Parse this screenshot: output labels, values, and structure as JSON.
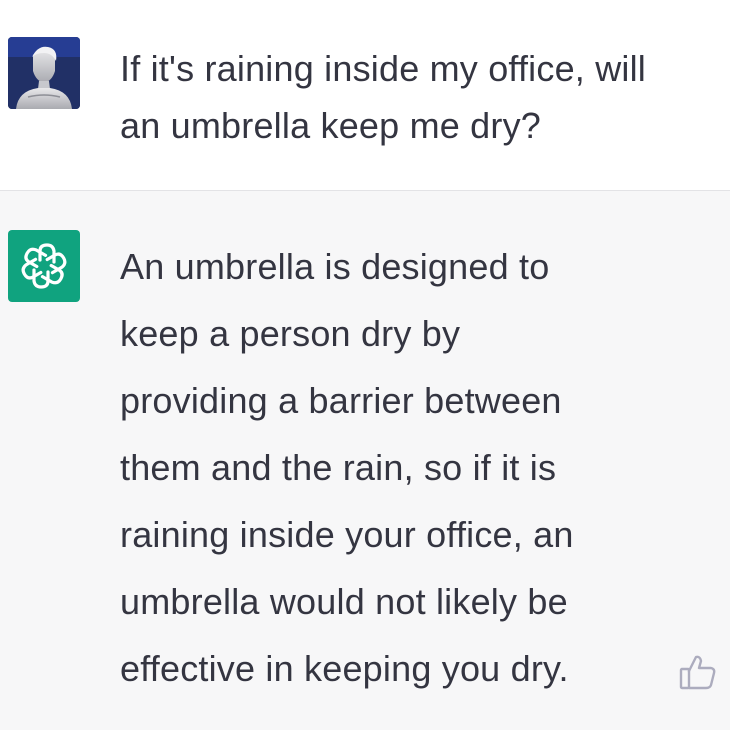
{
  "conversation": {
    "user_message": {
      "avatar_icon": "user-photo-avatar",
      "text": "If it's raining inside my office, will\nan umbrella keep me dry?"
    },
    "assistant_message": {
      "avatar_icon": "openai-logo-icon",
      "avatar_color": "#10a37f",
      "text": "An umbrella is designed to\nkeep a person dry by\nproviding a barrier between\nthem and the rain, so if it is\nraining inside your office, an\numbrella would not likely be\neffective in keeping you dry.",
      "feedback_icon": "thumbs-up-icon"
    },
    "colors": {
      "text": "#343541",
      "assistant_background": "#f7f7f8",
      "divider": "#e3e3e6"
    }
  }
}
